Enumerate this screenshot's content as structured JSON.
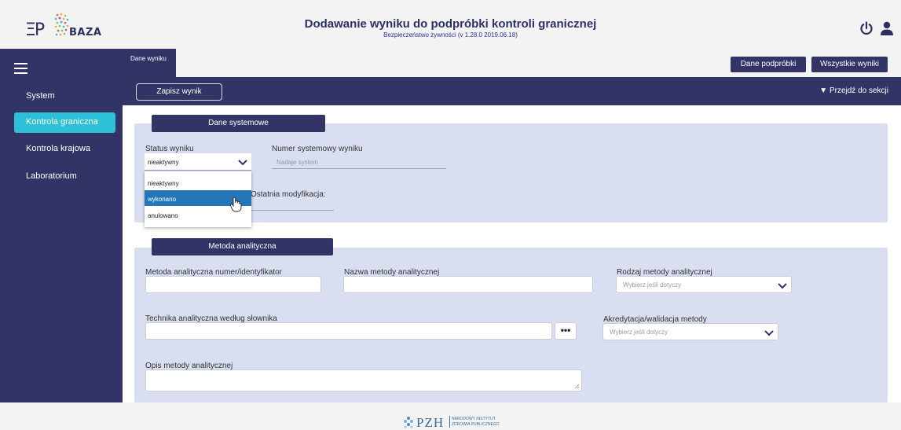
{
  "header": {
    "logo_text": "BAZA",
    "title": "Dodawanie wyniku do podpróbki kontroli granicznej",
    "subtitle": "Bezpieczeństwo żywności (v 1.28.0 2019.06.18)"
  },
  "sidebar": {
    "items": [
      {
        "label": "System"
      },
      {
        "label": "Kontrola graniczna",
        "active": true
      },
      {
        "label": "Kontrola krajowa"
      },
      {
        "label": "Laboratorium"
      }
    ]
  },
  "tabs": {
    "active_label": "Dane wyniku",
    "dane_podprobki_label": "Dane podpróbki",
    "wszystkie_wyniki_label": "Wszystkie wyniki"
  },
  "toolbar": {
    "save_label": "Zapisz wynik",
    "goto_label": "▼ Przejdź do sekcji"
  },
  "section_system": {
    "title": "Dane systemowe",
    "status_label": "Status wyniku",
    "status_value": "nieaktywny",
    "status_options": [
      "nieaktywny",
      "wykonano",
      "anulowano"
    ],
    "status_highlighted": "wykonano",
    "numer_label": "Numer systemowy wyniku",
    "numer_placeholder": "Nadaje system",
    "modyfikacja_label": "Ostatnia modyfikacja:"
  },
  "section_method": {
    "title": "Metoda analityczna",
    "metoda_id_label": "Metoda analityczna numer/identyfikator",
    "nazwa_label": "Nazwa metody analitycznej",
    "rodzaj_label": "Rodzaj metody analitycznej",
    "rodzaj_placeholder": "Wybierz jeśli dotyczy",
    "technika_label": "Technika analityczna według słownika",
    "technika_button": "•••",
    "akredytacja_label": "Akredytacja/walidacja metody",
    "akredytacja_placeholder": "Wybierz jeśli dotyczy",
    "opis_label": "Opis metody analitycznej"
  },
  "footer": {
    "logo_text": "PZH",
    "institute_line1": "NARODOWY INSTYTUT",
    "institute_line2": "ZDROWIA PUBLICZNEGO"
  },
  "colors": {
    "primary_dark": "#333466",
    "accent_active": "#2ec0d6",
    "panel_bg": "#d9dff0",
    "selected_option": "#2576b8"
  }
}
